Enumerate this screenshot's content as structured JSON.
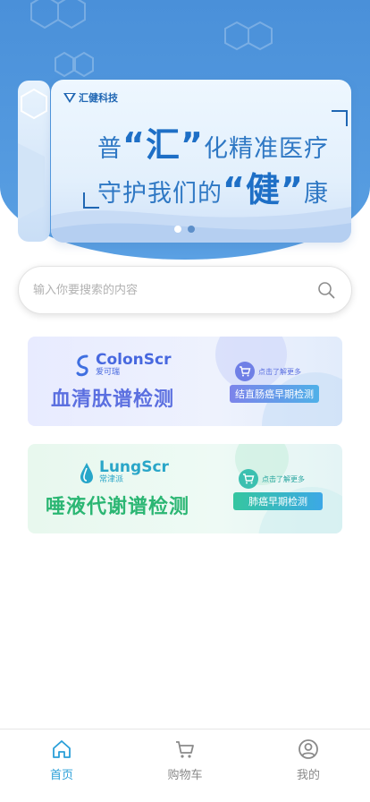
{
  "banner": {
    "logo_text": "汇健科技",
    "line1": [
      "普",
      "“汇”",
      "化精准医疗"
    ],
    "line2": [
      "守护我们的",
      "“健”",
      "康"
    ],
    "dots_total": 2,
    "dot_active_index": 0
  },
  "search": {
    "placeholder": "输入你要搜索的内容",
    "value": ""
  },
  "products": [
    {
      "brand_en": "ColonScr",
      "brand_cn": "爱可瑞",
      "title": "血清肽谱检测",
      "more": "点击了解更多",
      "tag": "结直肠癌早期检测",
      "accent": "#5b6fe0"
    },
    {
      "brand_en": "LungScr",
      "brand_cn": "常津派",
      "title": "唾液代谢谱检测",
      "more": "点击了解更多",
      "tag": "肺癌早期检测",
      "accent": "#2bb673"
    }
  ],
  "tabbar": {
    "items": [
      {
        "label": "首页",
        "icon": "home-icon",
        "active": true
      },
      {
        "label": "购物车",
        "icon": "cart-icon",
        "active": false
      },
      {
        "label": "我的",
        "icon": "user-icon",
        "active": false
      }
    ],
    "active_color": "#2a9fd8",
    "inactive_color": "#8a8a8a"
  }
}
